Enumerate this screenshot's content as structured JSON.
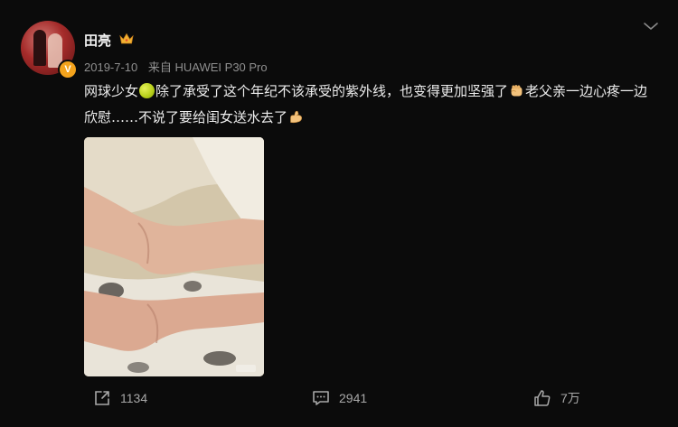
{
  "user": {
    "name": "田亮",
    "verified_mark": "V",
    "crown_icon": "crown-icon"
  },
  "post": {
    "date": "2019-7-10",
    "source": "来自 HUAWEI P30 Pro",
    "text_part1": "网球少女",
    "text_part2": "除了承受了这个年纪不该承受的紫外线，也变得更加坚强了",
    "text_part3": "老父亲一边心疼一边欣慰……不说了要给闺女送水去了",
    "emojis": [
      "tennis-ball-icon",
      "fist-icon",
      "flexed-biceps-icon"
    ]
  },
  "actions": {
    "reposts": "1134",
    "comments": "2941",
    "likes": "7万"
  },
  "colors": {
    "background": "#0b0b0b",
    "text": "#ededed",
    "meta": "#8f8f8f",
    "badge": "#f4a31c"
  }
}
